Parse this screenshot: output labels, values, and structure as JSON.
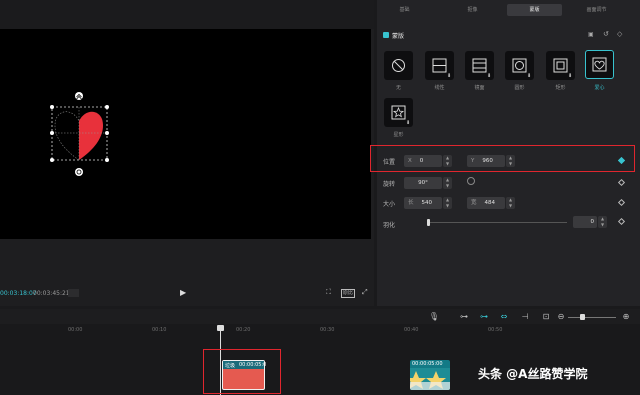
{
  "player": {
    "current_time": "00:03:18:07",
    "total_time": "00:03:45:21",
    "ratio_label": "原比"
  },
  "inspector": {
    "tabs": [
      {
        "label": "基础"
      },
      {
        "label": "抠像"
      },
      {
        "label": "蒙版"
      },
      {
        "label": "画面调节"
      }
    ],
    "active_tab_index": 2,
    "section_title": "蒙版",
    "masks": [
      {
        "label": "无",
        "icon": "no-mask-icon"
      },
      {
        "label": "线性",
        "icon": "linear-mask-icon"
      },
      {
        "label": "镜面",
        "icon": "mirror-mask-icon"
      },
      {
        "label": "圆形",
        "icon": "circle-mask-icon"
      },
      {
        "label": "矩形",
        "icon": "rect-mask-icon"
      },
      {
        "label": "爱心",
        "icon": "heart-mask-icon"
      },
      {
        "label": "星形",
        "icon": "star-mask-icon"
      }
    ],
    "selected_mask": "爱心",
    "position": {
      "label": "位置",
      "x_prefix": "X",
      "x_value": "0",
      "y_prefix": "Y",
      "y_value": "960"
    },
    "rotate": {
      "label": "旋转",
      "value": "90°"
    },
    "size": {
      "label": "大小",
      "w_prefix": "长",
      "w_value": "540",
      "h_prefix": "宽",
      "h_value": "484"
    },
    "feather": {
      "label": "羽化",
      "value": "0"
    },
    "accent_color": "#38c3cf"
  },
  "timeline": {
    "ruler": [
      "00:00",
      "00:10",
      "00:20",
      "00:30",
      "00:40",
      "00:50"
    ],
    "clip1": {
      "name": "垃圾",
      "duration": "00:00:05:0"
    },
    "clip2": {
      "duration": "00:00:05:00"
    }
  },
  "watermark": "头条 @A丝路赞学院"
}
